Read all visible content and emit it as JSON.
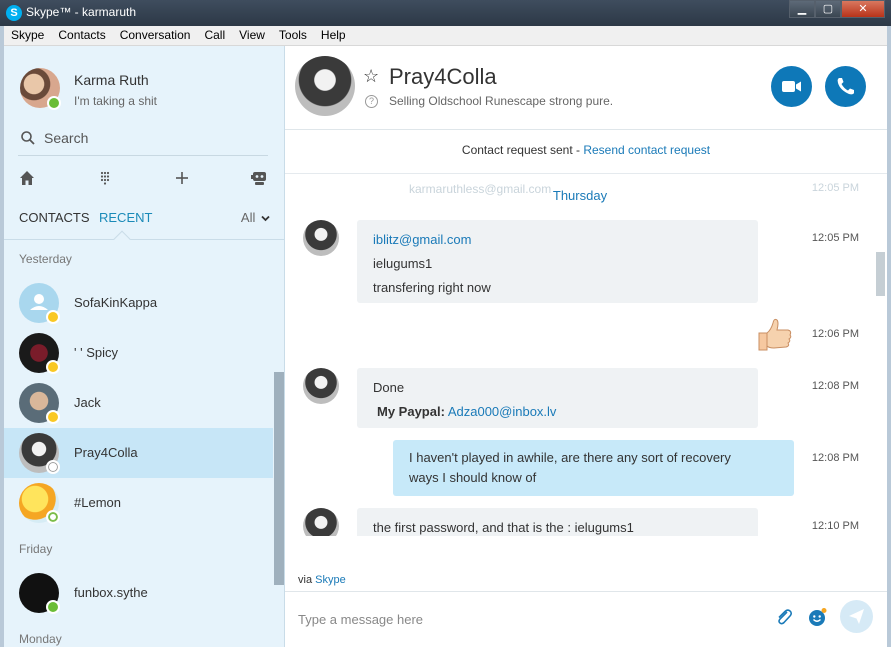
{
  "window": {
    "title": "Skype™ - karmaruth",
    "logo_letter": "S",
    "minimize": "▁",
    "maximize": "▢",
    "close": "✕"
  },
  "menu": [
    "Skype",
    "Contacts",
    "Conversation",
    "Call",
    "View",
    "Tools",
    "Help"
  ],
  "profile": {
    "name": "Karma Ruth",
    "mood": "I'm taking a shit",
    "status": "online"
  },
  "search": {
    "label": "Search"
  },
  "toolbar": {
    "home_icon": "home-icon",
    "dialpad_icon": "dialpad-icon",
    "add_icon": "add-icon",
    "bots_icon": "bots-icon"
  },
  "tabs": {
    "contacts": "CONTACTS",
    "recent": "RECENT",
    "filter": "All"
  },
  "sections": {
    "yesterday": "Yesterday",
    "friday": "Friday",
    "monday": "Monday"
  },
  "contacts": [
    {
      "name": "SofaKinKappa",
      "status": "away"
    },
    {
      "name": "' ' Spicy",
      "status": "away"
    },
    {
      "name": "Jack",
      "status": "away"
    },
    {
      "name": "Pray4Colla",
      "status": "unknown",
      "selected": true
    },
    {
      "name": "#Lemon",
      "status": "offline"
    },
    {
      "name": "funbox.sythe",
      "status": "online"
    }
  ],
  "chat": {
    "name": "Pray4Colla",
    "mood": "Selling Oldschool Runescape strong pure.",
    "request_text": "Contact request sent - ",
    "request_link": "Resend contact request",
    "ghost_email": "karmaruthless@gmail.com",
    "ghost_time": "12:05 PM",
    "day": "Thursday",
    "messages": [
      {
        "lines": [
          "iblitz@gmail.com",
          "ielugums1",
          "transfering right now"
        ],
        "time": "12:05 PM"
      },
      {
        "sticker": "thumbs-up",
        "time": "12:06 PM"
      },
      {
        "done": "Done",
        "paypal_label": "My Paypal:",
        "paypal_value": "Adza000@inbox.lv",
        "time": "12:08 PM"
      },
      {
        "lines": [
          "I haven't played in awhile, are there any sort of recovery",
          "ways I should know of"
        ],
        "time": "12:08 PM"
      },
      {
        "lines": [
          "the first password, and that is the : ielugums1"
        ],
        "time": "12:10 PM"
      }
    ],
    "via_text": "via ",
    "via_link": "Skype",
    "compose_placeholder": "Type a message here"
  },
  "colors": {
    "accent": "#0e78b8",
    "link": "#1a7ab8",
    "sidebar_bg": "#e6f3fb",
    "selected_bg": "#c7e6f7",
    "my_bubble": "#c7e9f9",
    "their_bubble": "#eff2f4"
  }
}
